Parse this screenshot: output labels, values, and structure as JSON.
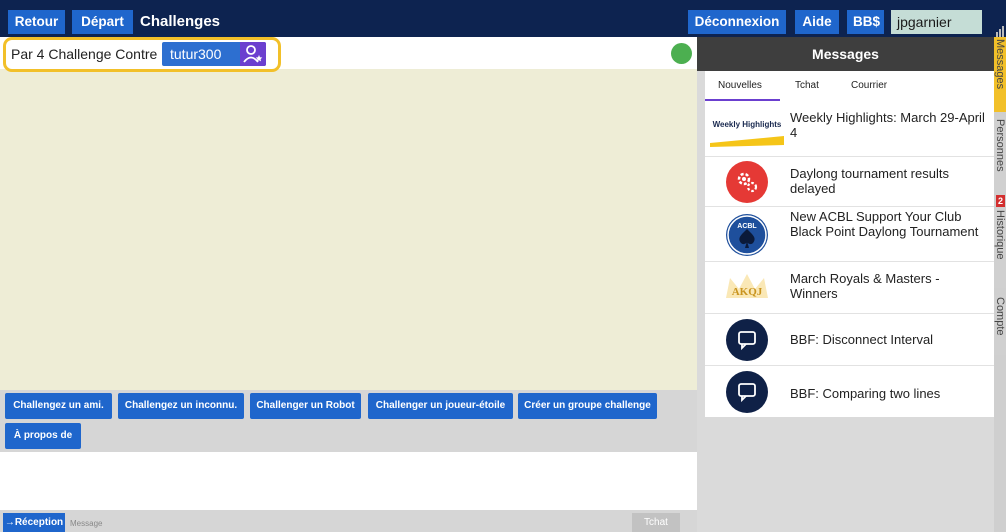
{
  "topbar": {
    "retour": "Retour",
    "depart": "Départ",
    "title": "Challenges",
    "deconnexion": "Déconnexion",
    "aide": "Aide",
    "bbs": "BB$",
    "username": "jpgarnier"
  },
  "game": {
    "header_text": "Par 4 Challenge Contre",
    "opponent": "tutur300",
    "status": "online",
    "buttons": [
      "Challengez un ami.",
      "Challengez un inconnu.",
      "Challenger un Robot",
      "Challenger un joueur-étoile",
      "Créer un groupe challenge",
      "À propos de"
    ]
  },
  "chat": {
    "reception": "→Réception",
    "message_placeholder": "Message",
    "tchat_button": "Tchat"
  },
  "messages": {
    "title": "Messages",
    "tabs": [
      "Nouvelles",
      "Tchat",
      "Courrier"
    ],
    "active_tab": "Nouvelles",
    "items": [
      {
        "text": "Weekly Highlights: March 29-April 4",
        "icon": "weekly-highlights-logo",
        "logo_text": "Weekly Highlights"
      },
      {
        "text": "Daylong tournament results delayed",
        "icon": "gears-icon"
      },
      {
        "text": "New ACBL Support Your Club Black Point Daylong Tournament",
        "icon": "acbl-logo",
        "logo_text": "ACBL"
      },
      {
        "text": "March Royals & Masters - Winners",
        "icon": "akqj-crown-icon",
        "logo_text": "AKQJ"
      },
      {
        "text": "BBF: Disconnect Interval",
        "icon": "chat-bubble-icon"
      },
      {
        "text": "BBF: Comparing two lines",
        "icon": "chat-bubble-icon"
      }
    ]
  },
  "side_tabs": [
    {
      "label": "Messages",
      "active": true
    },
    {
      "label": "Personnes",
      "badge": "2"
    },
    {
      "label": "Historique"
    },
    {
      "label": "Compte"
    }
  ],
  "colors": {
    "topbar": "#0d2350",
    "button_blue": "#1f66cc",
    "accent_purple": "#6b3fcf",
    "highlight": "#f2c029",
    "game_bg": "#eeedd6",
    "online_green": "#4caf50"
  }
}
